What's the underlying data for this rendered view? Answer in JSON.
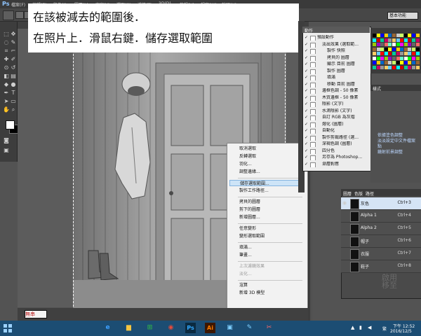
{
  "app": {
    "logo": "Ps",
    "menu": [
      "檔案(F)",
      "編輯(E)",
      "影像(I)",
      "圖層(L)",
      "文字(Y)",
      "選取(S)",
      "濾鏡(T)",
      "3D(D)",
      "檢視(V)",
      "視窗(W)",
      "說明(H)"
    ],
    "workspace": "基本功能"
  },
  "instruction": {
    "line1": "在該被減去的範圍後．",
    "line2": "在照片上．滑鼠右鍵．儲存選取範圍"
  },
  "context_menu": {
    "items": [
      {
        "label": "取消選取",
        "disabled": false,
        "highlight": false
      },
      {
        "label": "反轉選取",
        "disabled": false,
        "highlight": false
      },
      {
        "label": "羽化...",
        "disabled": false,
        "highlight": false
      },
      {
        "label": "調整邊緣...",
        "disabled": false,
        "highlight": false
      },
      {
        "sep": true
      },
      {
        "label": "儲存選取範圍...",
        "disabled": false,
        "highlight": true
      },
      {
        "label": "製作工作路徑...",
        "disabled": false,
        "highlight": false
      },
      {
        "sep": true
      },
      {
        "label": "拷貝的圖層",
        "disabled": false,
        "highlight": false
      },
      {
        "label": "剪下的圖層",
        "disabled": false,
        "highlight": false
      },
      {
        "label": "新增圖層...",
        "disabled": false,
        "highlight": false
      },
      {
        "sep": true
      },
      {
        "label": "任意變形",
        "disabled": false,
        "highlight": false
      },
      {
        "label": "變形選取範圍",
        "disabled": false,
        "highlight": false
      },
      {
        "sep": true
      },
      {
        "label": "填滿...",
        "disabled": false,
        "highlight": false
      },
      {
        "label": "筆畫...",
        "disabled": false,
        "highlight": false
      },
      {
        "sep": true
      },
      {
        "label": "上次濾鏡效果",
        "disabled": true,
        "highlight": false
      },
      {
        "label": "淡化...",
        "disabled": true,
        "highlight": false
      },
      {
        "sep": true
      },
      {
        "label": "渲算",
        "disabled": false,
        "highlight": false
      },
      {
        "label": "新增 3D 模型",
        "disabled": false,
        "highlight": false
      }
    ]
  },
  "actions_panel": {
    "tab": "動作",
    "rows": [
      {
        "label": "預設動作",
        "indent": 0
      },
      {
        "label": "淡出效果 (選取範...",
        "indent": 1
      },
      {
        "label": "製作 快照",
        "indent": 2
      },
      {
        "label": "拷貝的 圖層",
        "indent": 2
      },
      {
        "label": "顯示 目前 圖層",
        "indent": 2
      },
      {
        "label": "製作 圖層",
        "indent": 2
      },
      {
        "label": "填滿",
        "indent": 2
      },
      {
        "label": "移動 目前 圖層",
        "indent": 2
      },
      {
        "label": "邊框色調 - 50 像素",
        "indent": 1
      },
      {
        "label": "木質邊框 - 50 像素",
        "indent": 1
      },
      {
        "label": "陰影 (文字)",
        "indent": 1
      },
      {
        "label": "水滴陰影 (文字)",
        "indent": 1
      },
      {
        "label": "自訂 RGB 為灰階",
        "indent": 1
      },
      {
        "label": "熔化 (圖層)",
        "indent": 1
      },
      {
        "label": "自動化",
        "indent": 1
      },
      {
        "label": "製作剪裁路徑 (選...",
        "indent": 1
      },
      {
        "label": "深褐色調 (圖層)",
        "indent": 1
      },
      {
        "label": "四分色",
        "indent": 1
      },
      {
        "label": "另存為 Photoshop...",
        "indent": 1
      },
      {
        "label": "漸層對應",
        "indent": 1
      }
    ]
  },
  "adjust_panel": {
    "tab": "樣式",
    "blue_lines": [
      "依據塗色調整",
      "淡淡設定中文件檔案",
      "點",
      "鏡射前景調整"
    ]
  },
  "channels_panel": {
    "tabs": [
      "圖層",
      "色版",
      "路徑"
    ],
    "rows": [
      {
        "name": "灰色",
        "shortcut": "Ctrl+3",
        "selected": true,
        "visible": true
      },
      {
        "name": "Alpha 1",
        "shortcut": "Ctrl+4",
        "selected": false,
        "visible": false
      },
      {
        "name": "Alpha 2",
        "shortcut": "Ctrl+5",
        "selected": false,
        "visible": false
      },
      {
        "name": "帽子",
        "shortcut": "Ctrl+6",
        "selected": false,
        "visible": false
      },
      {
        "name": "衣服",
        "shortcut": "Ctrl+7",
        "selected": false,
        "visible": false
      },
      {
        "name": "鞋子",
        "shortcut": "Ctrl+8",
        "selected": false,
        "visible": false
      }
    ]
  },
  "status": {
    "zoom": "無串"
  },
  "watermark": [
    "啟用",
    "移至"
  ],
  "taskbar": {
    "lang": "繁",
    "time": "下午 12:52",
    "date": "2016/12/5",
    "apps": [
      "IE",
      "Explorer",
      "Store",
      "Chrome",
      "Ps",
      "Ai",
      "Photos",
      "Sketch",
      "Snip"
    ]
  },
  "colors": {
    "highlight": "#cde4f7",
    "taskbar": "#1c4d73",
    "ps_blue": "#8fc4ff"
  }
}
